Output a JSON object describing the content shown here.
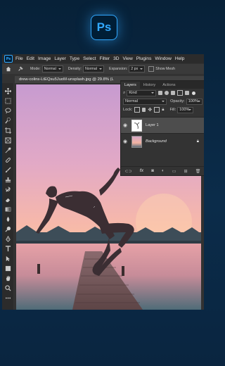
{
  "logo": {
    "text": "Ps"
  },
  "menubar": {
    "app_icon": "Ps",
    "items": [
      "File",
      "Edit",
      "Image",
      "Layer",
      "Type",
      "Select",
      "Filter",
      "3D",
      "View",
      "Plugins",
      "Window",
      "Help"
    ]
  },
  "options_bar": {
    "mode_label": "Mode:",
    "mode_value": "Normal",
    "density_label": "Density:",
    "density_value": "Normal",
    "expansion_label": "Expansion:",
    "expansion_value": "2 px",
    "show_mesh_label": "Show Mesh"
  },
  "document": {
    "tab_title": "drew-colins-LtEQsu5JuoM-unsplash.jpg @ 29.8% (L"
  },
  "layers_panel": {
    "tabs": [
      "Layers",
      "History",
      "Actions"
    ],
    "kind_value": "Kind",
    "blend_mode": "Normal",
    "opacity_label": "Opacity:",
    "opacity_value": "100%",
    "lock_label": "Lock:",
    "fill_label": "Fill:",
    "fill_value": "100%",
    "layers": [
      {
        "name": "Layer 1"
      },
      {
        "name": "Background"
      }
    ],
    "footer_icons": [
      "link-icon",
      "fx-icon",
      "mask-icon",
      "adjustment-icon",
      "group-icon",
      "new-layer-icon",
      "trash-icon"
    ]
  },
  "tools": [
    "move",
    "marquee",
    "lasso",
    "quick-select",
    "crop",
    "frame",
    "eyedropper",
    "healing",
    "brush",
    "stamp",
    "history-brush",
    "eraser",
    "gradient",
    "blur",
    "dodge",
    "pen",
    "type",
    "path-select",
    "shape",
    "hand",
    "zoom",
    "more"
  ],
  "colors": {
    "accent": "#31a8ff",
    "ps_bg": "#001e36"
  }
}
